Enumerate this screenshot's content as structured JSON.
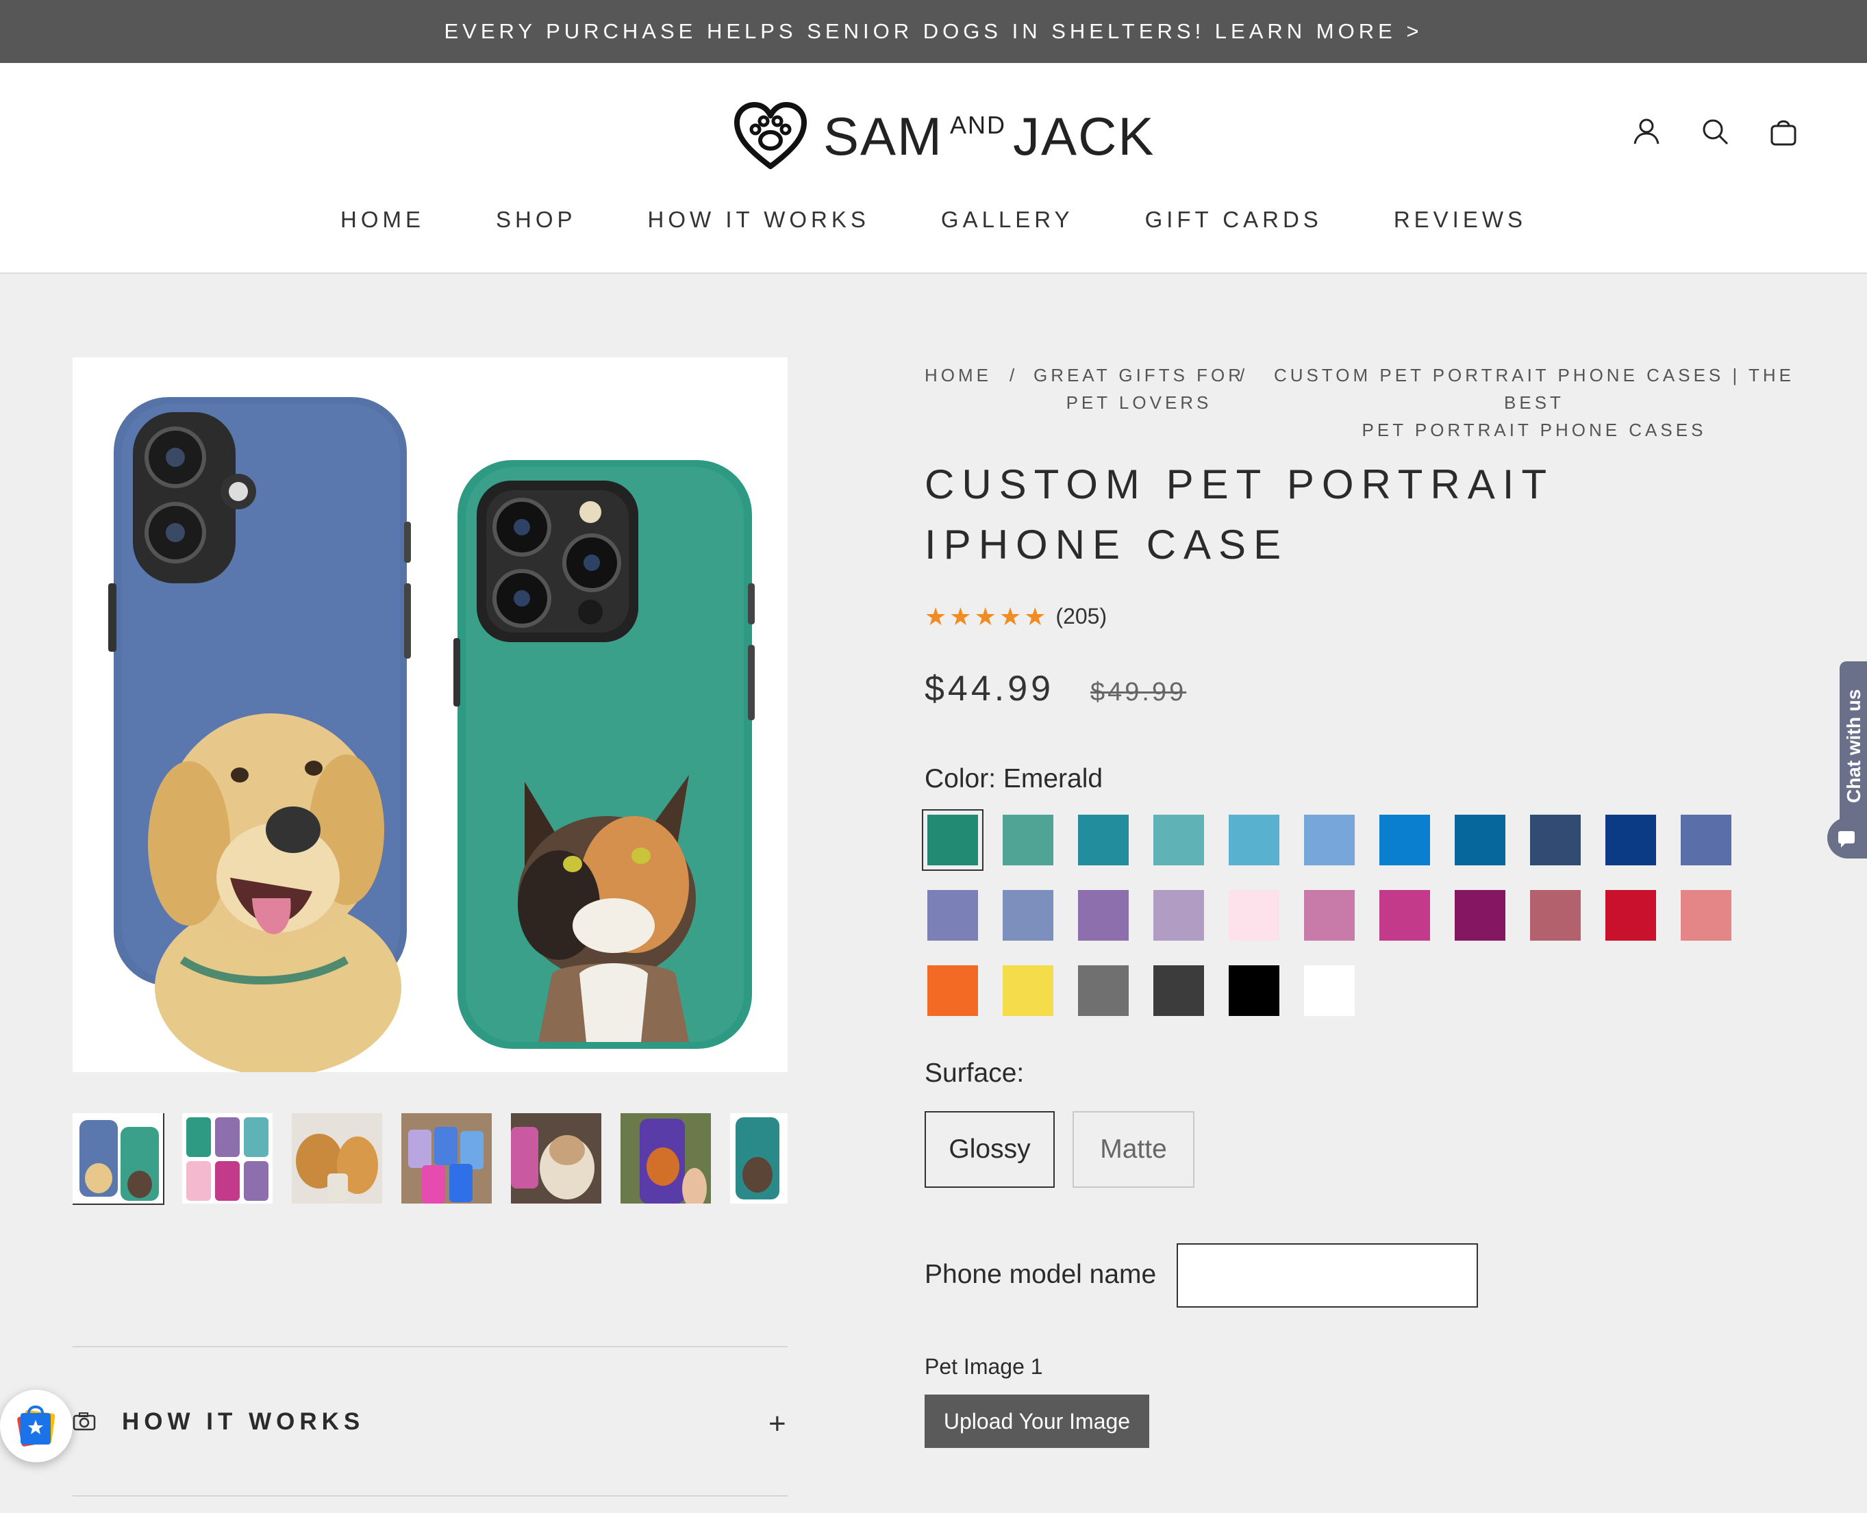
{
  "announcement": "EVERY PURCHASE HELPS SENIOR DOGS IN SHELTERS! LEARN MORE >",
  "logo": {
    "main": "SAM",
    "and": "AND",
    "end": "JACK"
  },
  "nav": [
    "HOME",
    "SHOP",
    "HOW IT WORKS",
    "GALLERY",
    "GIFT CARDS",
    "REVIEWS"
  ],
  "breadcrumb": {
    "home": "HOME",
    "sep": "/",
    "cat_line1": "GREAT GIFTS FOR",
    "cat_line2": "PET LOVERS",
    "col_line1": "CUSTOM PET PORTRAIT PHONE CASES | THE BEST",
    "col_line2": "PET PORTRAIT PHONE CASES"
  },
  "product": {
    "title": "CUSTOM PET PORTRAIT IPHONE CASE",
    "rating": 5,
    "review_count": "(205)",
    "price": "$44.99",
    "compare_price": "$49.99"
  },
  "color": {
    "label": "Color: Emerald",
    "selected": 0,
    "swatches": [
      "#228a72",
      "#4fa495",
      "#228d9c",
      "#5fb3b7",
      "#58b2cf",
      "#77a7da",
      "#0a7ecf",
      "#05679b",
      "#314b72",
      "#0c3b86",
      "#5a6faa",
      "#7b80b6",
      "#7d8fbd",
      "#8e6fae",
      "#b19cc4",
      "#fde2ec",
      "#c87ba8",
      "#c43a8a",
      "#841662",
      "#b2616d",
      "#c9102c",
      "#e48688",
      "#f26a23",
      "#f4dc4a",
      "#707070",
      "#3c3c3c",
      "#000000",
      "#ffffff"
    ]
  },
  "surface": {
    "label": "Surface:",
    "options": [
      "Glossy",
      "Matte"
    ],
    "selected": "Glossy"
  },
  "phone_model": {
    "label": "Phone model name",
    "value": ""
  },
  "pet_image": {
    "label": "Pet Image 1",
    "button": "Upload Your Image"
  },
  "accordion": {
    "title": "HOW IT WORKS"
  },
  "chat": {
    "label": "Chat with us"
  },
  "icons": [
    "account-icon",
    "search-icon",
    "cart-icon",
    "camera-icon",
    "plus-icon",
    "chat-icon",
    "shop-app-icon"
  ]
}
